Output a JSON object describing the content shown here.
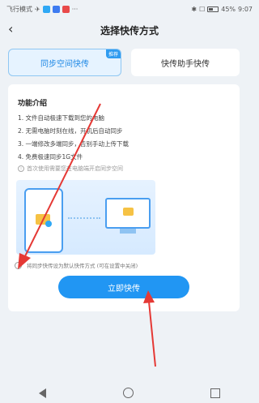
{
  "status_bar": {
    "left_text": "飞行模式",
    "battery": "45%",
    "time": "9:07"
  },
  "header": {
    "back_icon": "chevron-left-icon",
    "title": "选择快传方式"
  },
  "tabs": {
    "sync_label": "同步空间快传",
    "sync_badge": "推荐",
    "helper_label": "快传助手快传"
  },
  "features": {
    "title": "功能介绍",
    "items": [
      "1. 文件自动极速下载到您的电脑",
      "2. 无需电脑时刻在线，开机后自动同步",
      "3. 一端修改多端同步，告别手动上传下载",
      "4. 免费极速同步1G文件"
    ],
    "note": "首次使用需要您在电脑端开启同步空间"
  },
  "consent": {
    "text": "将同步快传设为默认快传方式 (可在设置中关闭)"
  },
  "primary_button": {
    "label": "立即快传"
  },
  "colors": {
    "accent": "#2196f3",
    "annotation_arrow": "#e53935"
  }
}
